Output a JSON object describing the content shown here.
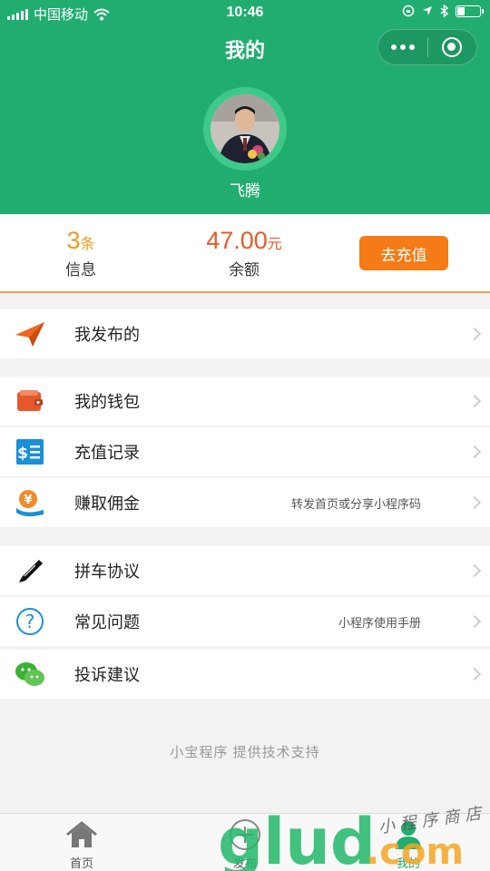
{
  "status_bar": {
    "carrier": "中国移动",
    "time": "10:46"
  },
  "header": {
    "title": "我的"
  },
  "profile": {
    "name": "飞腾"
  },
  "stats": {
    "messages": {
      "value": "3",
      "unit": "条",
      "label": "信息"
    },
    "balance": {
      "value": "47.00",
      "unit": "元",
      "label": "余额"
    },
    "recharge_label": "去充值"
  },
  "menu": [
    {
      "label": "我发布的",
      "hint": "",
      "icon": "paper-plane-icon"
    },
    {
      "label": "我的钱包",
      "hint": "",
      "icon": "wallet-icon"
    },
    {
      "label": "充值记录",
      "hint": "",
      "icon": "receipt-icon"
    },
    {
      "label": "赚取佣金",
      "hint": "转发首页或分享小程序码",
      "icon": "commission-icon"
    },
    {
      "label": "拼车协议",
      "hint": "",
      "icon": "pencil-icon"
    },
    {
      "label": "常见问题",
      "hint": "小程序使用手册",
      "icon": "question-icon"
    },
    {
      "label": "投诉建议",
      "hint": "",
      "icon": "wechat-icon"
    }
  ],
  "footer_note": "小宝程序 提供技术支持",
  "tabbar": [
    {
      "label": "首页",
      "icon": "home-icon"
    },
    {
      "label": "发布",
      "icon": "plus-circle-icon"
    },
    {
      "label": "我的",
      "icon": "person-icon",
      "active": true
    }
  ],
  "watermark": {
    "text": "glud",
    "suffix": ".com",
    "tagline": "小程序商店"
  },
  "colors": {
    "primary": "#22ad70",
    "accent": "#f57b17",
    "balance": "#e85a2a"
  }
}
